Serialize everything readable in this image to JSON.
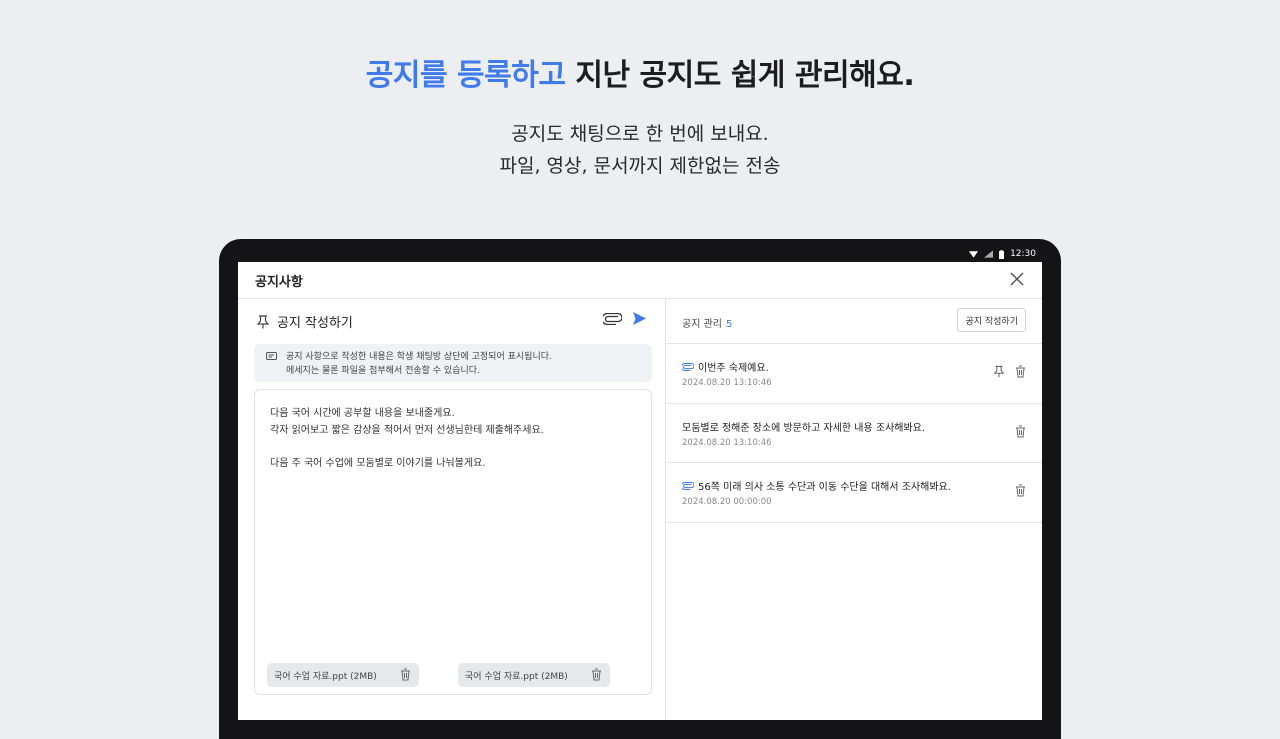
{
  "headline": {
    "accent": "공지를 등록하고",
    "rest": " 지난 공지도 쉽게 관리해요."
  },
  "subtitle": {
    "line1": "공지도 채팅으로 한 번에 보내요.",
    "line2": "파일, 영상, 문서까지 제한없는 전송"
  },
  "status": {
    "time": "12:30"
  },
  "app": {
    "title": "공지사항",
    "compose": {
      "label": "공지 작성하기",
      "info_line1": "공지 사항으로 작성한 내용은 학생 채팅방 상단에 고정되어 표시됩니다.",
      "info_line2": "메세지는 물론 파일을 첨부해서 전송할 수 있습니다.",
      "body_line1": "다음 국어 시간에 공부할 내용을 보내줄게요.",
      "body_line2": "각자 읽어보고 짧은 감상을 적어서 먼저 선생님한테 제출해주세요.",
      "body_line3": "다음 주 국어 수업에 모둠별로 이야기를 나눠볼게요.",
      "attachments": [
        "국어 수업 자료.ppt (2MB)",
        "국어 수업 자료.ppt (2MB)"
      ]
    },
    "manage": {
      "label": "공지 관리",
      "count": "5",
      "write_button": "공지 작성하기",
      "items": [
        {
          "text": "이번주 숙제예요.",
          "date": "2024.08.20 13:10:46"
        },
        {
          "text": "모둠별로 정해준 장소에 방문하고 자세한 내용 조사해봐요.",
          "date": "2024.08.20 13:10:46"
        },
        {
          "text": "56쪽 미래 의사 소통 수단과 이동 수단을 대해서 조사해봐요.",
          "date": "2024.08.20 00:00:00"
        }
      ]
    }
  },
  "colors": {
    "accent": "#3f7bea",
    "background": "#eceef2"
  },
  "icons": [
    "pin-icon",
    "paperclip-icon",
    "send-icon",
    "close-icon",
    "trash-icon",
    "info-icon",
    "wifi-icon",
    "signal-icon",
    "battery-icon"
  ]
}
